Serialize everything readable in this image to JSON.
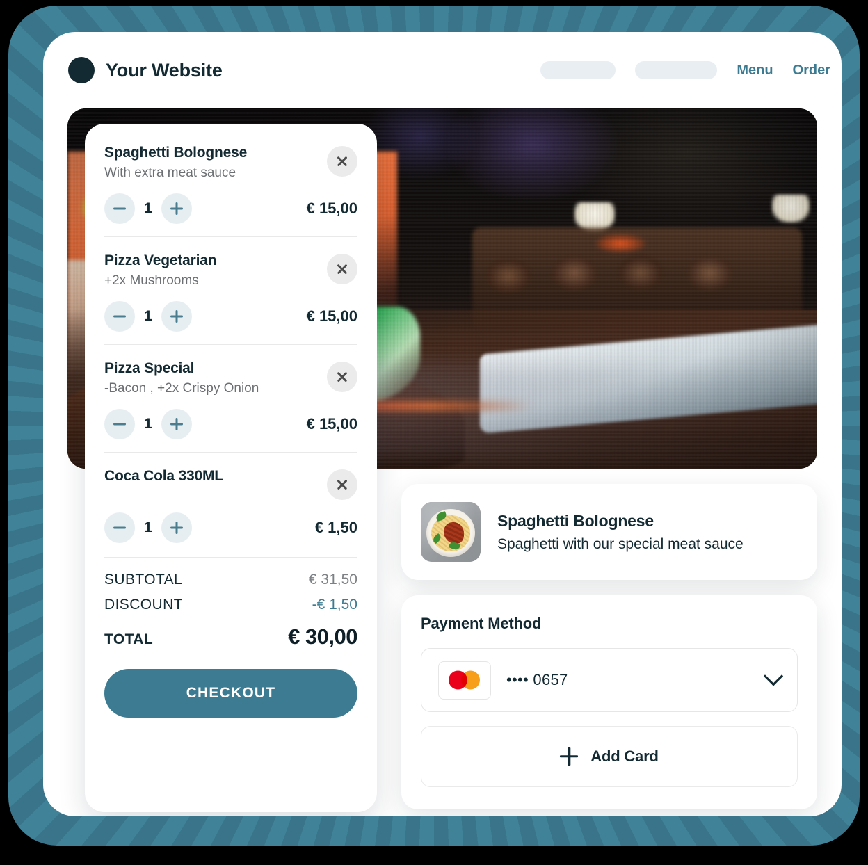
{
  "header": {
    "brand_name": "Your Website",
    "nav_links": [
      "Menu",
      "Order"
    ]
  },
  "hero": {
    "alt": "sushi-platter-photo"
  },
  "cart": {
    "items": [
      {
        "name": "Spaghetti Bolognese",
        "options": "With extra meat sauce",
        "quantity": "1",
        "price": "€ 15,00"
      },
      {
        "name": "Pizza Vegetarian",
        "options": "+2x Mushrooms",
        "quantity": "1",
        "price": "€ 15,00"
      },
      {
        "name": "Pizza Special",
        "options": "-Bacon , +2x Crispy Onion",
        "quantity": "1",
        "price": "€ 15,00"
      },
      {
        "name": "Coca Cola 330ML",
        "options": "",
        "quantity": "1",
        "price": "€ 1,50"
      }
    ],
    "totals": {
      "subtotal_label": "SUBTOTAL",
      "subtotal_value": "€ 31,50",
      "discount_label": "DISCOUNT",
      "discount_value": "-€ 1,50",
      "total_label": "TOTAL",
      "total_value": "€ 30,00"
    },
    "checkout_label": "CHECKOUT"
  },
  "product": {
    "name": "Spaghetti Bolognese",
    "description": "Spaghetti with our special meat sauce"
  },
  "payment": {
    "title": "Payment Method",
    "selected_card": "•••• 0657",
    "card_brand": "mastercard",
    "add_card_label": "Add Card"
  },
  "colors": {
    "accent_teal": "#3c7b91",
    "dark_navy": "#132a33",
    "stepper_bg": "#e7eef2",
    "close_bg": "#ebebeb",
    "mc_red": "#eb001b",
    "mc_orange": "#f79e1b"
  }
}
